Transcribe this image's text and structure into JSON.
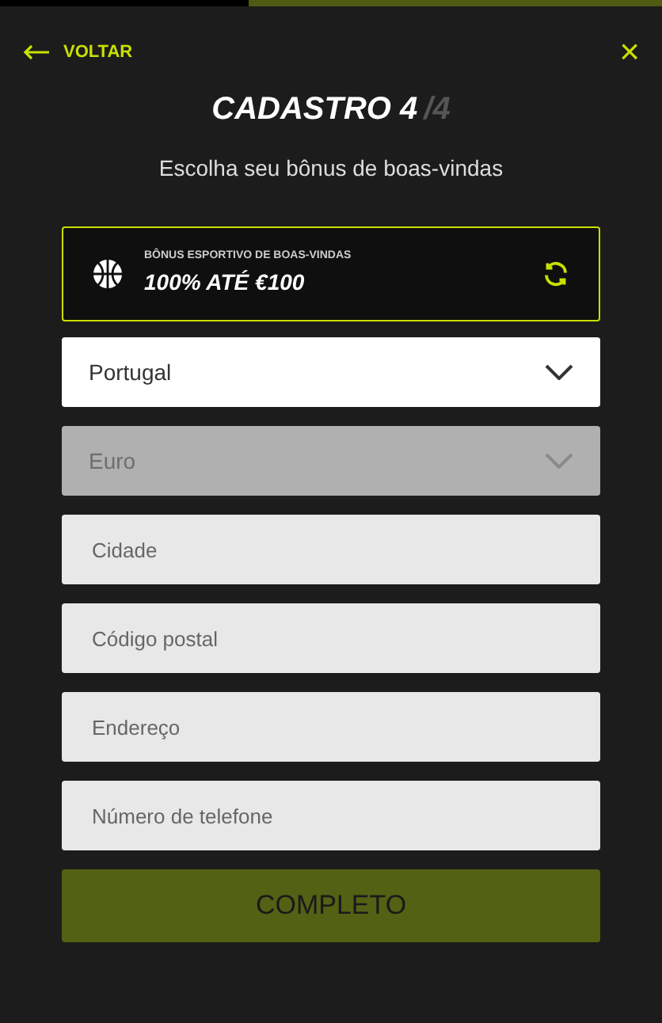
{
  "header": {
    "back": "VOLTAR",
    "close": "×"
  },
  "title": {
    "main": "CADASTRO 4",
    "total": "/4"
  },
  "subtitle": "Escolha seu bônus de boas-vindas",
  "bonus": {
    "label": "BÔNUS ESPORTIVO DE BOAS-VINDAS",
    "offer": "100% ATÉ €100"
  },
  "fields": [
    {
      "kind": "select",
      "value": "Portugal",
      "disabled": false
    },
    {
      "kind": "select",
      "value": "Euro",
      "disabled": true
    },
    {
      "kind": "input",
      "placeholder": "Cidade"
    },
    {
      "kind": "input",
      "placeholder": "Código postal"
    },
    {
      "kind": "input",
      "placeholder": "Endereço"
    },
    {
      "kind": "input",
      "placeholder": "Número de telefone"
    }
  ],
  "submit": {
    "label": "COMPLETO",
    "disabled": true
  }
}
